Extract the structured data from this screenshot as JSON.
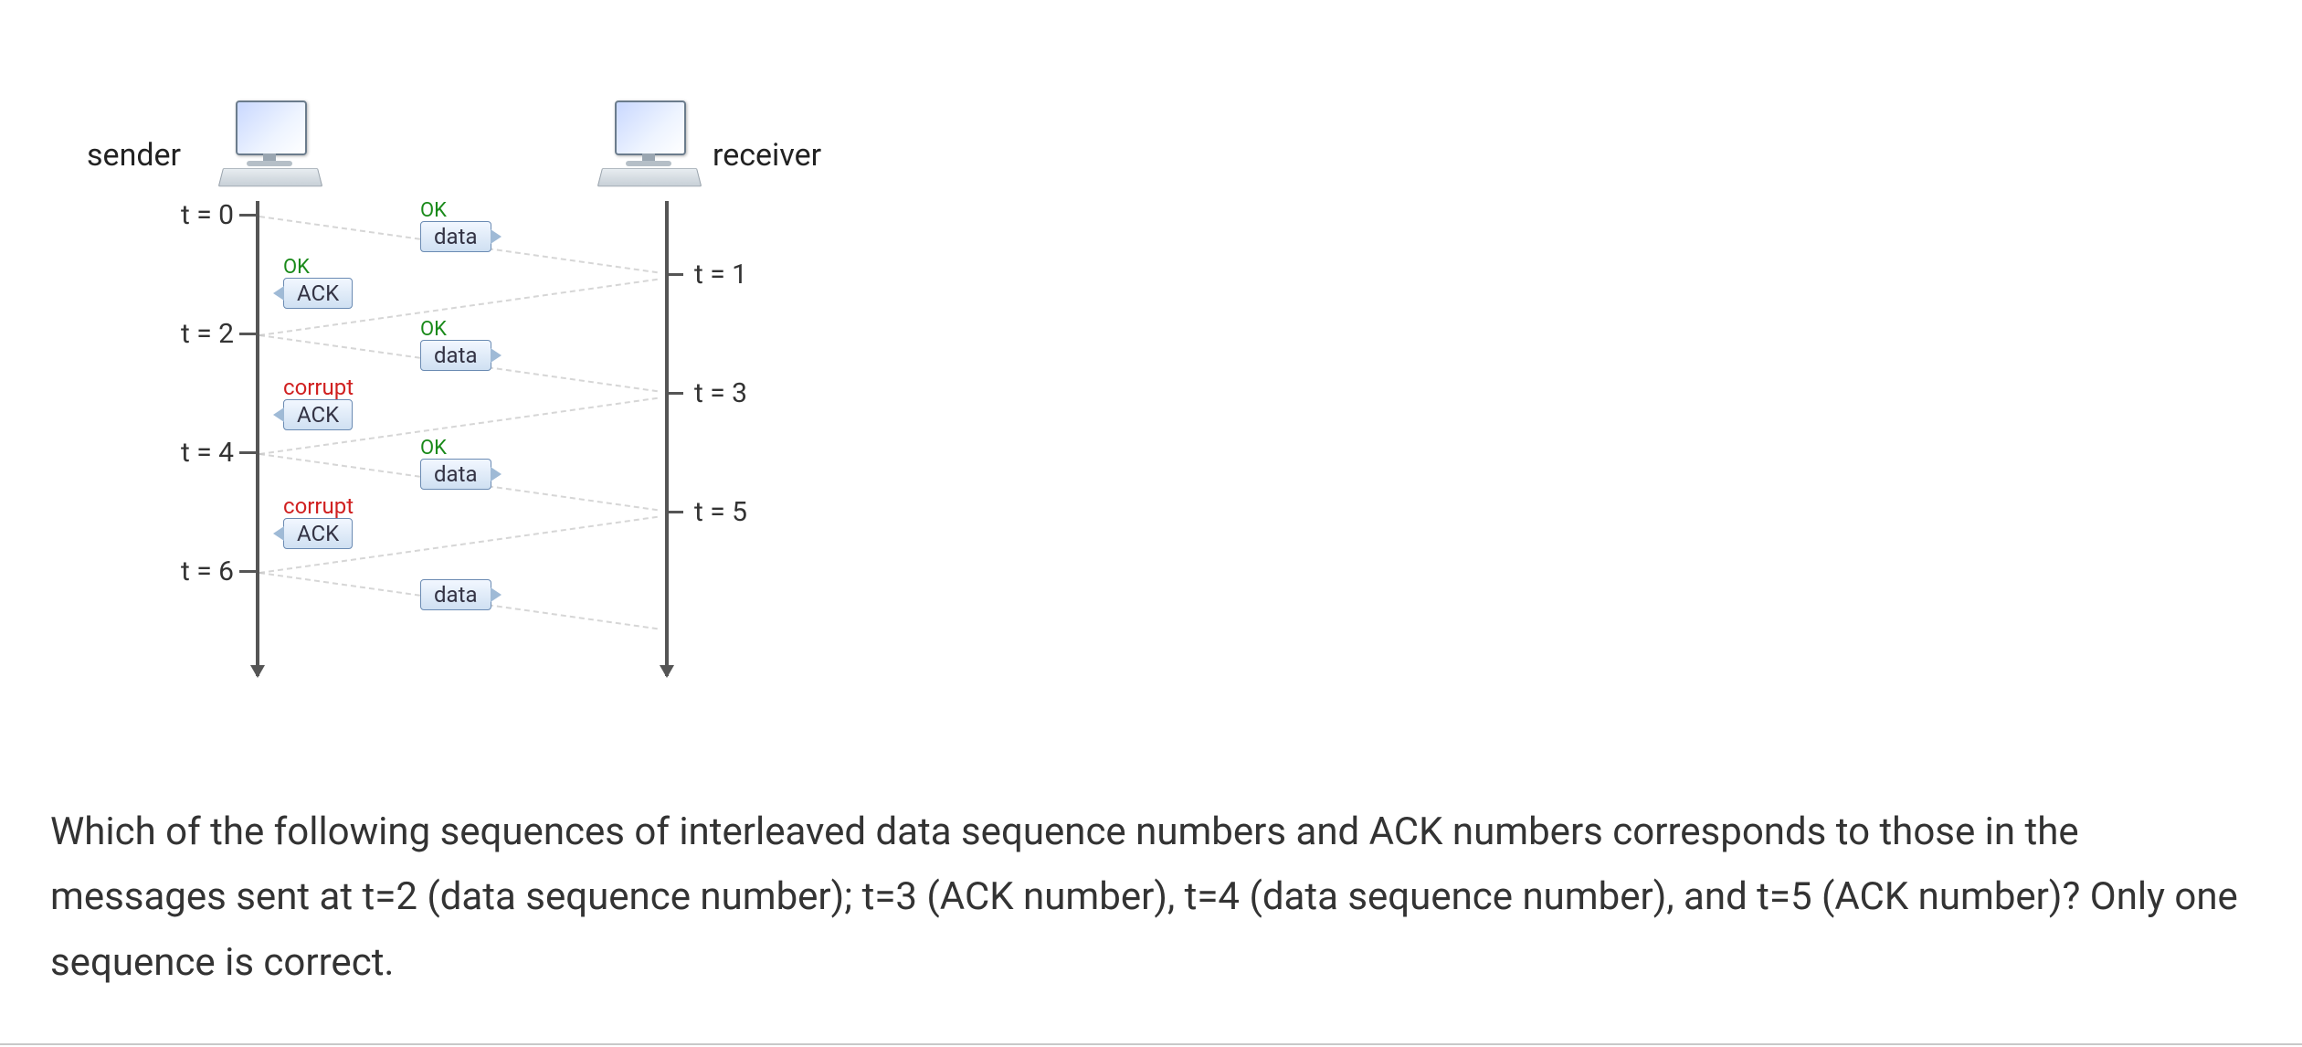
{
  "labels": {
    "sender": "sender",
    "receiver": "receiver"
  },
  "time_marks": {
    "t0": "t = 0",
    "t1": "t = 1",
    "t2": "t = 2",
    "t3": "t = 3",
    "t4": "t = 4",
    "t5": "t = 5",
    "t6": "t = 6"
  },
  "messages": {
    "data": "data",
    "ack": "ACK",
    "ok": "OK",
    "corrupt": "corrupt"
  },
  "events": [
    {
      "t_send": 0,
      "t_recv": 1,
      "dir": "s2r",
      "kind": "data",
      "status": "OK"
    },
    {
      "t_send": 1,
      "t_recv": 2,
      "dir": "r2s",
      "kind": "ACK",
      "status": "OK"
    },
    {
      "t_send": 2,
      "t_recv": 3,
      "dir": "s2r",
      "kind": "data",
      "status": "OK"
    },
    {
      "t_send": 3,
      "t_recv": 4,
      "dir": "r2s",
      "kind": "ACK",
      "status": "corrupt"
    },
    {
      "t_send": 4,
      "t_recv": 5,
      "dir": "s2r",
      "kind": "data",
      "status": "OK"
    },
    {
      "t_send": 5,
      "t_recv": 6,
      "dir": "r2s",
      "kind": "ACK",
      "status": "corrupt"
    },
    {
      "t_send": 6,
      "t_recv": 7,
      "dir": "s2r",
      "kind": "data",
      "status": ""
    }
  ],
  "question": "Which of the following sequences of interleaved data sequence numbers and ACK numbers corresponds to those in the messages sent at t=2 (data sequence number); t=3 (ACK number), t=4 (data sequence number), and t=5 (ACK number)?  Only one sequence is correct."
}
